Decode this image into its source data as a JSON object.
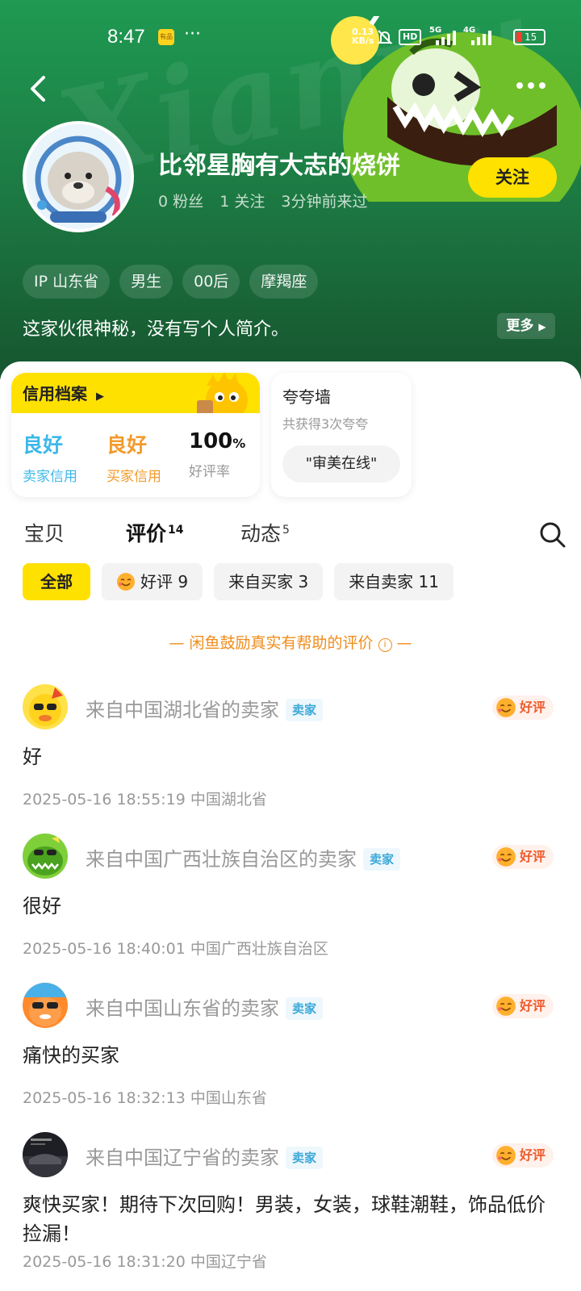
{
  "status_bar": {
    "time": "8:47",
    "app_icon_text": "有品",
    "overflow": "···",
    "net_speed_top": "0.13",
    "net_speed_bottom": "KB/s",
    "hd": "HD",
    "net_5g": "5G",
    "net_4g": "4G",
    "battery": "15"
  },
  "header": {
    "watermark": "Xianyu",
    "username": "比邻星胸有大志的烧饼",
    "stats": {
      "fans": "0 粉丝",
      "follow": "1 关注",
      "last_seen": "3分钟前来过"
    },
    "follow_button": "关注",
    "tags": [
      "IP 山东省",
      "男生",
      "00后",
      "摩羯座"
    ],
    "bio": "这家伙很神秘，没有写个人简介。",
    "bio_more": "更多"
  },
  "credit": {
    "title": "信用档案",
    "seller_value": "良好",
    "seller_label": "卖家信用",
    "buyer_value": "良好",
    "buyer_label": "买家信用",
    "rate_value": "100",
    "rate_unit": "%",
    "rate_label": "好评率"
  },
  "praise": {
    "title": "夸夸墙",
    "subtitle": "共获得3次夸夸",
    "chip": "\"审美在线\""
  },
  "tabs": [
    {
      "label": "宝贝",
      "count": ""
    },
    {
      "label": "评价",
      "count": "14"
    },
    {
      "label": "动态",
      "count": "5"
    }
  ],
  "filters": {
    "all": "全部",
    "good": "好评 9",
    "from_buyer": "来自买家 3",
    "from_seller": "来自卖家 11"
  },
  "notice": "— 闲鱼鼓励真实有帮助的评价",
  "notice_end": "—",
  "reviews": [
    {
      "name": "来自中国湖北省的卖家",
      "role": "卖家",
      "badge": "好评",
      "text": "好",
      "time": "2025-05-16 18:55:19",
      "location": "中国湖北省"
    },
    {
      "name": "来自中国广西壮族自治区的卖家",
      "role": "卖家",
      "badge": "好评",
      "text": "很好",
      "time": "2025-05-16 18:40:01",
      "location": "中国广西壮族自治区"
    },
    {
      "name": "来自中国山东省的卖家",
      "role": "卖家",
      "badge": "好评",
      "text": "痛快的买家",
      "time": "2025-05-16 18:32:13",
      "location": "中国山东省"
    },
    {
      "name": "来自中国辽宁省的卖家",
      "role": "卖家",
      "badge": "好评",
      "text": "爽快买家！期待下次回购！男装，女装，球鞋潮鞋，饰品低价捡漏！",
      "time": "2025-05-16 18:31:20",
      "location": "中国辽宁省"
    }
  ],
  "colors": {
    "brand_yellow": "#ffe100",
    "header_green": "#1d7e45",
    "seller_blue": "#3db8e9",
    "buyer_orange": "#f29b2c",
    "good_red": "#ef5b2c"
  }
}
